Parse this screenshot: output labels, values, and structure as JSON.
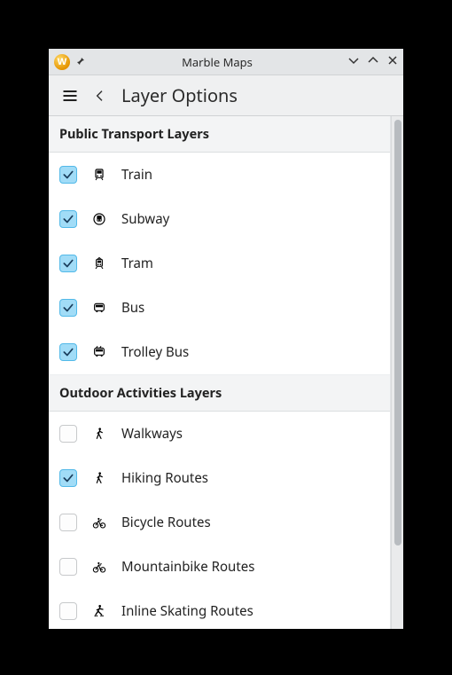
{
  "window": {
    "app_icon_letter": "W",
    "title": "Marble Maps"
  },
  "topbar": {
    "screen_title": "Layer Options"
  },
  "sections": [
    {
      "title": "Public Transport Layers",
      "items": [
        {
          "label": "Train",
          "checked": true,
          "icon": "train-icon"
        },
        {
          "label": "Subway",
          "checked": true,
          "icon": "subway-icon"
        },
        {
          "label": "Tram",
          "checked": true,
          "icon": "tram-icon"
        },
        {
          "label": "Bus",
          "checked": true,
          "icon": "bus-icon"
        },
        {
          "label": "Trolley Bus",
          "checked": true,
          "icon": "trolleybus-icon"
        }
      ]
    },
    {
      "title": "Outdoor Activities Layers",
      "items": [
        {
          "label": "Walkways",
          "checked": false,
          "icon": "walk-icon"
        },
        {
          "label": "Hiking Routes",
          "checked": true,
          "icon": "hike-icon"
        },
        {
          "label": "Bicycle Routes",
          "checked": false,
          "icon": "bicycle-icon"
        },
        {
          "label": "Mountainbike Routes",
          "checked": false,
          "icon": "mountainbike-icon"
        },
        {
          "label": "Inline Skating Routes",
          "checked": false,
          "icon": "skate-icon"
        }
      ]
    }
  ],
  "colors": {
    "check_fill": "#a1dcf7",
    "check_border": "#52b9e8"
  }
}
